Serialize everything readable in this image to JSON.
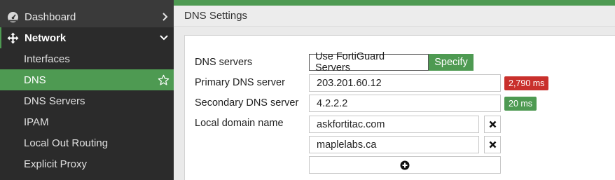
{
  "sidebar": {
    "dashboard": {
      "label": "Dashboard",
      "icon": "gauge-icon"
    },
    "network": {
      "label": "Network",
      "icon": "move-arrows-icon"
    },
    "items": [
      {
        "label": "Interfaces"
      },
      {
        "label": "DNS",
        "active": true
      },
      {
        "label": "DNS Servers"
      },
      {
        "label": "IPAM"
      },
      {
        "label": "Local Out Routing"
      },
      {
        "label": "Explicit Proxy"
      }
    ]
  },
  "header": {
    "title": "DNS Settings"
  },
  "form": {
    "dns_servers": {
      "label": "DNS servers",
      "options": [
        "Use FortiGuard Servers",
        "Specify"
      ],
      "selected": "Specify"
    },
    "primary": {
      "label": "Primary DNS server",
      "value": "203.201.60.12",
      "latency": "2,790 ms",
      "latency_color": "#c9302c"
    },
    "secondary": {
      "label": "Secondary DNS server",
      "value": "4.2.2.2",
      "latency": "20 ms",
      "latency_color": "#4e9a52"
    },
    "local_domain": {
      "label": "Local domain name",
      "values": [
        "askfortitac.com",
        "maplelabs.ca"
      ]
    }
  },
  "colors": {
    "accent": "#4e9a52",
    "sidebar_bg": "#3a3a3a",
    "danger": "#c9302c"
  }
}
